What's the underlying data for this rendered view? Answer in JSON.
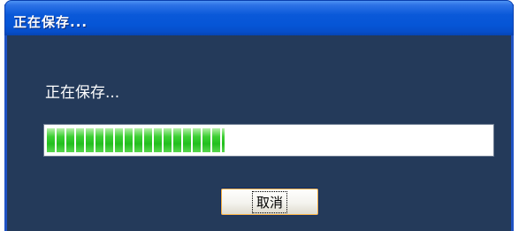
{
  "dialog": {
    "title": "正在保存...",
    "status_text": "正在保存...",
    "progress_percent": 40,
    "cancel_label": "取消"
  },
  "colors": {
    "titlebar": "#0655d6",
    "body": "#243a5a",
    "progress_fill": "#22bf1e"
  }
}
